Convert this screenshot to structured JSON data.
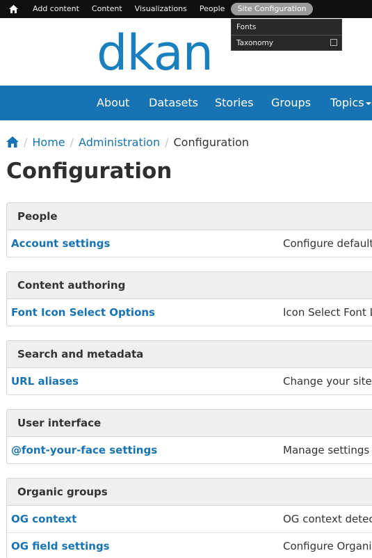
{
  "admin_bar": {
    "items": [
      "Add content",
      "Content",
      "Visualizations",
      "People",
      "Site Configuration"
    ],
    "dropdown": [
      "Fonts",
      "Taxonomy"
    ]
  },
  "logo": {
    "text": "dkan"
  },
  "nav": {
    "items": [
      "About",
      "Datasets",
      "Stories",
      "Groups",
      "Topics"
    ]
  },
  "breadcrumb": {
    "items": [
      "Home",
      "Administration"
    ],
    "current": "Configuration"
  },
  "page_title": "Configuration",
  "sections": [
    {
      "title": "People",
      "rows": [
        {
          "link": "Account settings",
          "desc": "Configure default"
        }
      ]
    },
    {
      "title": "Content authoring",
      "rows": [
        {
          "link": "Font Icon Select Options",
          "desc": "Icon Select Font L"
        }
      ]
    },
    {
      "title": "Search and metadata",
      "rows": [
        {
          "link": "URL aliases",
          "desc": "Change your site'"
        }
      ]
    },
    {
      "title": "User interface",
      "rows": [
        {
          "link": "@font-your-face settings",
          "desc": "Manage settings f"
        }
      ]
    },
    {
      "title": "Organic groups",
      "rows": [
        {
          "link": "OG context",
          "desc": "OG context detec"
        },
        {
          "link": "OG field settings",
          "desc": "Configure Organi"
        }
      ]
    }
  ],
  "colors": {
    "brand_blue": "#1873b2",
    "logo_blue": "#1a7fbe",
    "toolbar": "#0f0f0f"
  }
}
